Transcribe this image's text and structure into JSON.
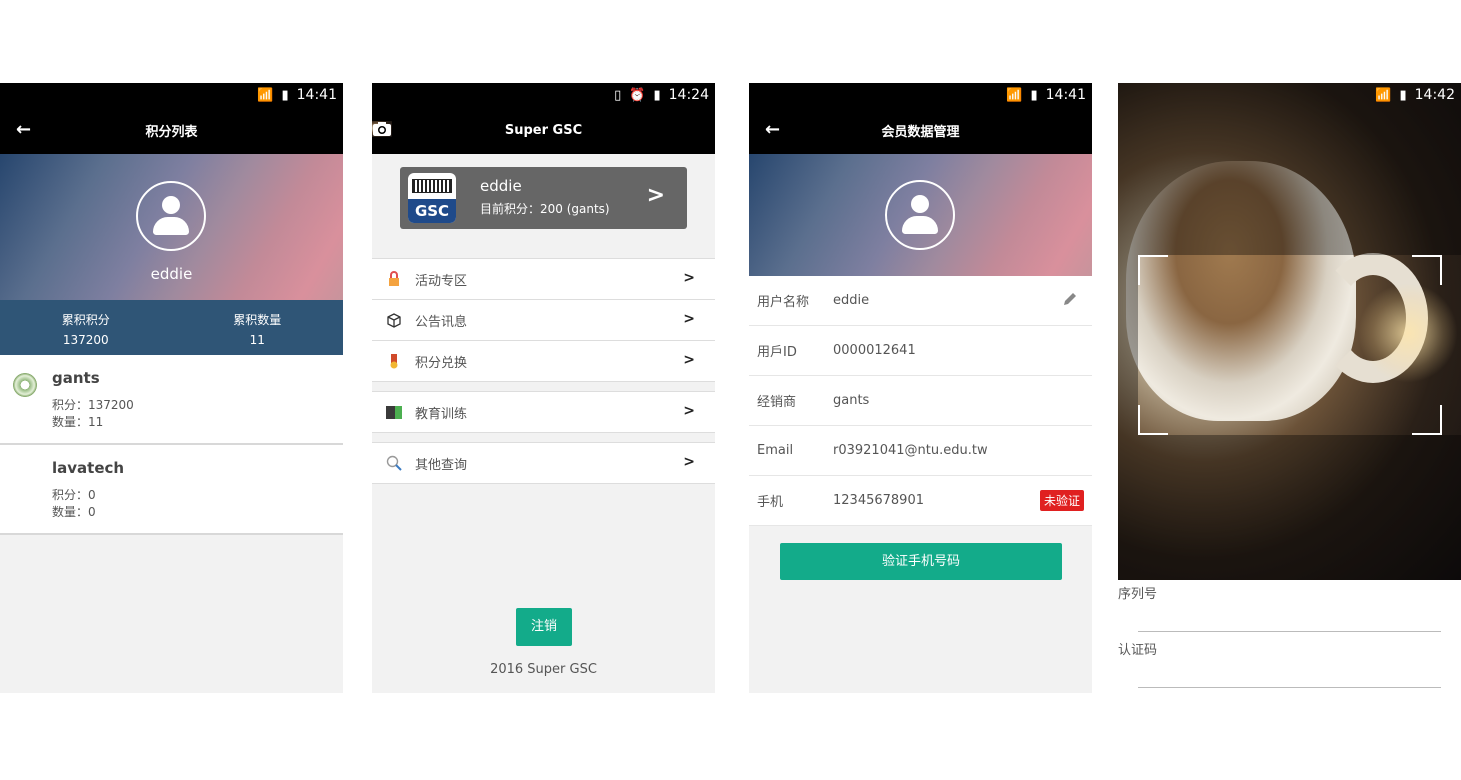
{
  "screen1": {
    "status_time": "14:41",
    "title": "积分列表",
    "user": "eddie",
    "stats": [
      {
        "label": "累积积分",
        "value": "137200"
      },
      {
        "label": "累积数量",
        "value": "11"
      }
    ],
    "cards": [
      {
        "name": "gants",
        "points": "积分：137200",
        "qty": "数量：11"
      },
      {
        "name": "lavatech",
        "points": "积分：0",
        "qty": "数量：0"
      }
    ]
  },
  "screen2": {
    "status_time": "14:24",
    "title": "Super GSC",
    "card": {
      "logo_text": "GSC",
      "name": "eddie",
      "points": "目前积分：200  (gants)"
    },
    "menu1": [
      {
        "label": "活动专区",
        "icon": "lock-icon"
      },
      {
        "label": "公告讯息",
        "icon": "box-icon"
      },
      {
        "label": "积分兑换",
        "icon": "medal-icon"
      }
    ],
    "menu2": [
      {
        "label": "教育训练",
        "icon": "board-icon"
      }
    ],
    "menu3": [
      {
        "label": "其他查询",
        "icon": "search-icon"
      }
    ],
    "logout": "注销",
    "copyright": "2016 Super GSC"
  },
  "screen3": {
    "status_time": "14:41",
    "title": "会员数据管理",
    "fields": [
      {
        "label": "用户名称",
        "value": "eddie"
      },
      {
        "label": "用戶ID",
        "value": "0000012641"
      },
      {
        "label": "经销商",
        "value": "gants"
      },
      {
        "label": "Email",
        "value": "r03921041@ntu.edu.tw"
      },
      {
        "label": "手机",
        "value": "12345678901"
      }
    ],
    "badge": "未验证",
    "verify_button": "验证手机号码"
  },
  "screen4": {
    "status_time": "14:42",
    "serial_label": "序列号",
    "auth_label": "认证码"
  },
  "colors": {
    "accent": "#13ab8a",
    "stats_bg": "#2f5576",
    "badge": "#e02020"
  }
}
